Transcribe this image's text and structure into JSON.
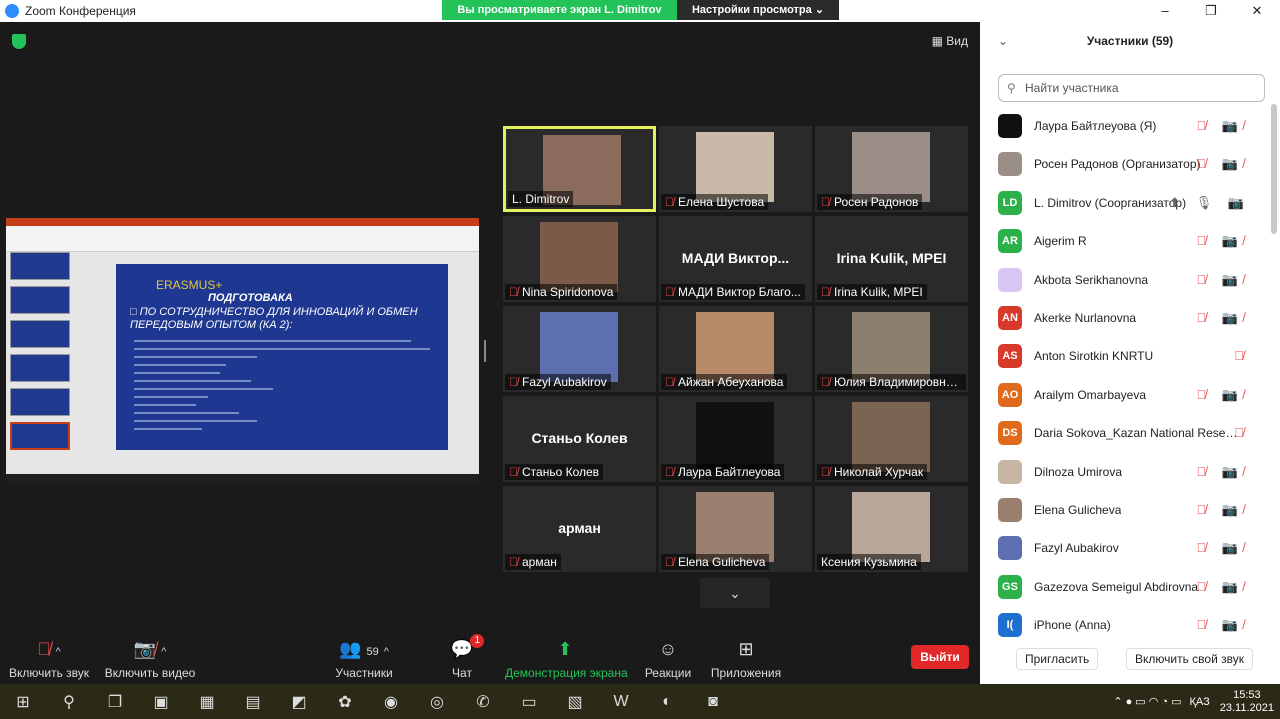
{
  "window": {
    "title": "Zoom Конференция",
    "controls": [
      "–",
      "❐",
      "✕"
    ]
  },
  "share_banner": {
    "viewing": "Вы просматриваете экран L. Dimitrov",
    "options": "Настройки просмотра ⌄"
  },
  "meeting": {
    "view_label": "Вид"
  },
  "slide": {
    "erasmus": "ERASMUS+",
    "title": "ПОДГОТОВАКА",
    "heading": "□ ПО СОТРУДНИЧЕСТВО ДЛЯ ИННОВАЦИЙ И ОБМЕН ПЕРЕДОВЫМ ОПЫТОМ (КА 2):"
  },
  "tiles": [
    {
      "name": "L. Dimitrov",
      "muted": false,
      "photo_color": "#8a6b5c",
      "active": true
    },
    {
      "name": "Елена Шустова",
      "muted": true,
      "photo_color": "#c9b9a9"
    },
    {
      "name": "Росен Радонов",
      "muted": true,
      "photo_color": "#9a8e86"
    },
    {
      "name": "Nina Spiridonova",
      "muted": true,
      "photo_color": "#7b5a4a"
    },
    {
      "name": "МАДИ Виктор Благо...",
      "muted": true,
      "big": "МАДИ Виктор..."
    },
    {
      "name": "Irina Kulik, MPEI",
      "muted": true,
      "big": "Irina Kulik, MPEI"
    },
    {
      "name": "Fazyl Aubakirov",
      "muted": true,
      "photo_color": "#5d6fb0"
    },
    {
      "name": "Айжан Абеуханова",
      "muted": true,
      "photo_color": "#b78a6a"
    },
    {
      "name": "Юлия Владимировна...",
      "muted": true,
      "photo_color": "#8d7f70"
    },
    {
      "name": "Станьо Колев",
      "muted": true,
      "big": "Станьо Колев"
    },
    {
      "name": "Лаура Байтлеуова",
      "muted": true,
      "photo_color": "#111111"
    },
    {
      "name": "Николай Хурчак",
      "muted": true,
      "photo_color": "#7a6452"
    },
    {
      "name": "арман",
      "muted": true,
      "big": "арман"
    },
    {
      "name": "Elena Gulicheva",
      "muted": true,
      "photo_color": "#9a7e6e"
    },
    {
      "name": "Ксения Кузьмина",
      "muted": false,
      "photo_color": "#b8a79a"
    }
  ],
  "controls": {
    "audio": "Включить звук",
    "video": "Включить видео",
    "participants": "Участники",
    "participants_count": "59",
    "chat": "Чат",
    "chat_badge": "1",
    "share": "Демонстрация экрана",
    "reactions": "Реакции",
    "apps": "Приложения",
    "leave": "Выйти"
  },
  "panel": {
    "title": "Участники (59)",
    "search_placeholder": "Найти участника",
    "participants": [
      {
        "name": "Лаура Байтлеуова (Я)",
        "initials": "",
        "color": "#111111",
        "icons": "🎙̸ 📷̸"
      },
      {
        "name": "Росен Радонов (Организатор)",
        "initials": "",
        "color": "#9a8e86",
        "icons": "🎙̸ 📷̸"
      },
      {
        "name": "L. Dimitrov (Соорганизатор)",
        "initials": "LD",
        "color": "#2bb04a",
        "icons": "⬆ 🎙 📷",
        "ok": true
      },
      {
        "name": "Aigerim R",
        "initials": "AR",
        "color": "#2bb04a",
        "icons": "🎙̸ 📷̸"
      },
      {
        "name": "Akbota Serikhanovna",
        "initials": "",
        "color": "#d9c6f2",
        "icons": "🎙̸ 📷̸"
      },
      {
        "name": "Akerke Nurlanovna",
        "initials": "AN",
        "color": "#d8392b",
        "icons": "🎙̸ 📷̸"
      },
      {
        "name": "Anton Sirotkin KNRTU",
        "initials": "AS",
        "color": "#d8392b",
        "icons": "🎙̸"
      },
      {
        "name": "Arailym Omarbayeva",
        "initials": "AO",
        "color": "#e06a1b",
        "icons": "🎙̸ 📷̸"
      },
      {
        "name": "Daria Sokova_Kazan National Resea...",
        "initials": "DS",
        "color": "#e06a1b",
        "icons": "🎙̸"
      },
      {
        "name": "Dilnoza Umirova",
        "initials": "",
        "color": "#c7b5a6",
        "icons": "🎙̸ 📷̸"
      },
      {
        "name": "Elena Gulicheva",
        "initials": "",
        "color": "#9a7e6e",
        "icons": "🎙̸ 📷̸"
      },
      {
        "name": "Fazyl Aubakirov",
        "initials": "",
        "color": "#5d6fb0",
        "icons": "🎙̸ 📷̸"
      },
      {
        "name": "Gazezova Semeigul Abdirovna",
        "initials": "GS",
        "color": "#2bb04a",
        "icons": "🎙̸ 📷̸"
      },
      {
        "name": "iPhone (Anna)",
        "initials": "I(",
        "color": "#1f6fd1",
        "icons": "🎙̸ 📷̸"
      }
    ],
    "invite": "Пригласить",
    "unmute_self": "Включить свой звук"
  },
  "taskbar": {
    "lang": "ҚАЗ",
    "time": "15:53",
    "date": "23.11.2021"
  }
}
